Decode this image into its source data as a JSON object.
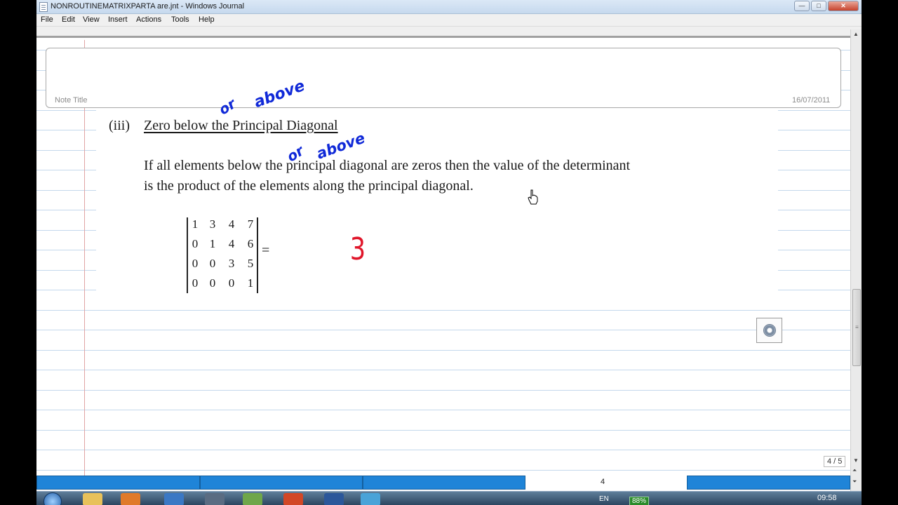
{
  "window": {
    "title": "NONROUTINEMATRIXPARTA are.jnt - Windows Journal",
    "controls": {
      "minimize": "—",
      "maximize": "□",
      "close": "✕"
    }
  },
  "menu": [
    "File",
    "Edit",
    "View",
    "Insert",
    "Actions",
    "Tools",
    "Help"
  ],
  "note": {
    "title_label": "Note Title",
    "date": "16/07/2011",
    "section_number": "(iii)",
    "section_title": "Zero below the Principal  Diagonal",
    "body_line1": "If all elements below the principal  diagonal are zeros then the value of the determinant",
    "body_line2": "is the product of the elements along the principal  diagonal.",
    "determinant": [
      [
        "1",
        "3",
        "4",
        "7"
      ],
      [
        "0",
        "1",
        "4",
        "6"
      ],
      [
        "0",
        "0",
        "3",
        "5"
      ],
      [
        "0",
        "0",
        "0",
        "1"
      ]
    ],
    "equals": "=",
    "ink": {
      "or_1": "or",
      "above_1": "above",
      "or_2": "or",
      "above_2": "above",
      "answer": "3"
    },
    "ink_colors": {
      "blue": "#1029d8",
      "red": "#e0162a"
    }
  },
  "status": {
    "page_indicator": "4 / 5",
    "page_bar_label": "4"
  },
  "taskbar": {
    "language": "EN",
    "battery": "88%",
    "clock": "09:58"
  },
  "icons": [
    "start-orb-icon",
    "eraser-icon",
    "hand-cursor-icon",
    "scroll-up-icon",
    "scroll-down-icon"
  ]
}
